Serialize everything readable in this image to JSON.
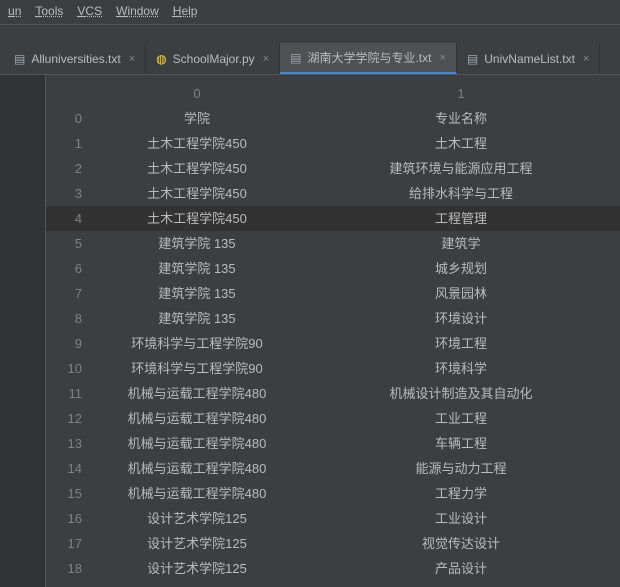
{
  "menu": [
    "un",
    "Tools",
    "VCS",
    "Window",
    "Help"
  ],
  "tabs": [
    {
      "label": "Alluniversities.txt",
      "icon": "txt",
      "active": false
    },
    {
      "label": "SchoolMajor.py",
      "icon": "py",
      "active": false
    },
    {
      "label": "湖南大学学院与专业.txt",
      "icon": "txt",
      "active": true
    },
    {
      "label": "UnivNameList.txt",
      "icon": "txt",
      "active": false
    }
  ],
  "header": {
    "col0": "0",
    "col1": "1"
  },
  "rows": [
    {
      "idx": "0",
      "a": "学院",
      "b": "专业名称"
    },
    {
      "idx": "1",
      "a": "土木工程学院450",
      "b": "土木工程"
    },
    {
      "idx": "2",
      "a": "土木工程学院450",
      "b": "建筑环境与能源应用工程"
    },
    {
      "idx": "3",
      "a": "土木工程学院450",
      "b": "给排水科学与工程"
    },
    {
      "idx": "4",
      "a": "土木工程学院450",
      "b": "工程管理",
      "hl": true
    },
    {
      "idx": "5",
      "a": "建筑学院 135",
      "b": "建筑学"
    },
    {
      "idx": "6",
      "a": "建筑学院 135",
      "b": "城乡规划"
    },
    {
      "idx": "7",
      "a": "建筑学院 135",
      "b": "风景园林"
    },
    {
      "idx": "8",
      "a": "建筑学院 135",
      "b": "环境设计"
    },
    {
      "idx": "9",
      "a": "环境科学与工程学院90",
      "b": "环境工程"
    },
    {
      "idx": "10",
      "a": "环境科学与工程学院90",
      "b": "环境科学"
    },
    {
      "idx": "11",
      "a": "机械与运载工程学院480",
      "b": "机械设计制造及其自动化"
    },
    {
      "idx": "12",
      "a": "机械与运载工程学院480",
      "b": "工业工程"
    },
    {
      "idx": "13",
      "a": "机械与运载工程学院480",
      "b": "车辆工程"
    },
    {
      "idx": "14",
      "a": "机械与运载工程学院480",
      "b": "能源与动力工程"
    },
    {
      "idx": "15",
      "a": "机械与运载工程学院480",
      "b": "工程力学"
    },
    {
      "idx": "16",
      "a": "设计艺术学院125",
      "b": "工业设计"
    },
    {
      "idx": "17",
      "a": "设计艺术学院125",
      "b": "视觉传达设计"
    },
    {
      "idx": "18",
      "a": "设计艺术学院125",
      "b": "产品设计"
    }
  ]
}
